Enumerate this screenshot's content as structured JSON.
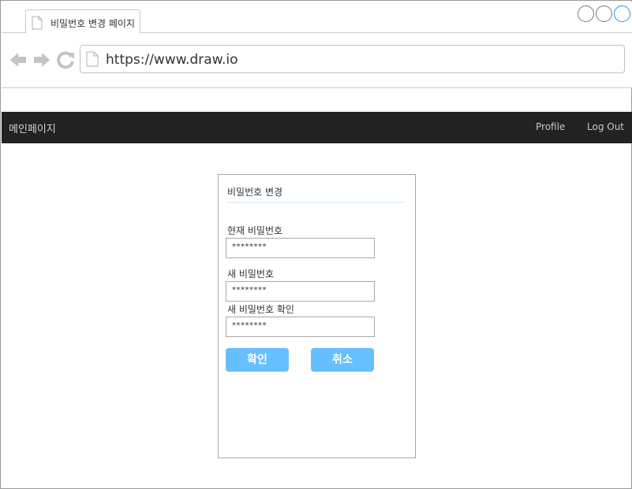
{
  "browser": {
    "tab_title": "비밀번호 변경 페이지",
    "url": "https://www.draw.io",
    "window_controls": [
      "minimize",
      "maximize",
      "close"
    ]
  },
  "navbar": {
    "brand": "메인페이지",
    "links": [
      "Profile",
      "Log Out"
    ]
  },
  "form": {
    "title": "비밀번호 변경",
    "fields": [
      {
        "label": "현재 비밀번호",
        "value": "********"
      },
      {
        "label": "새 비밀번호",
        "value": "********"
      },
      {
        "label": "새 비밀번호 확인",
        "value": "********"
      }
    ],
    "confirm_label": "확인",
    "cancel_label": "취소"
  },
  "colors": {
    "navbar_bg": "#222222",
    "button_bg": "#66bfff",
    "divider": "#e3f2fb",
    "active_control": "#1a9ae0"
  },
  "icons": [
    "document-icon",
    "back-arrow-icon",
    "forward-arrow-icon",
    "reload-icon"
  ]
}
